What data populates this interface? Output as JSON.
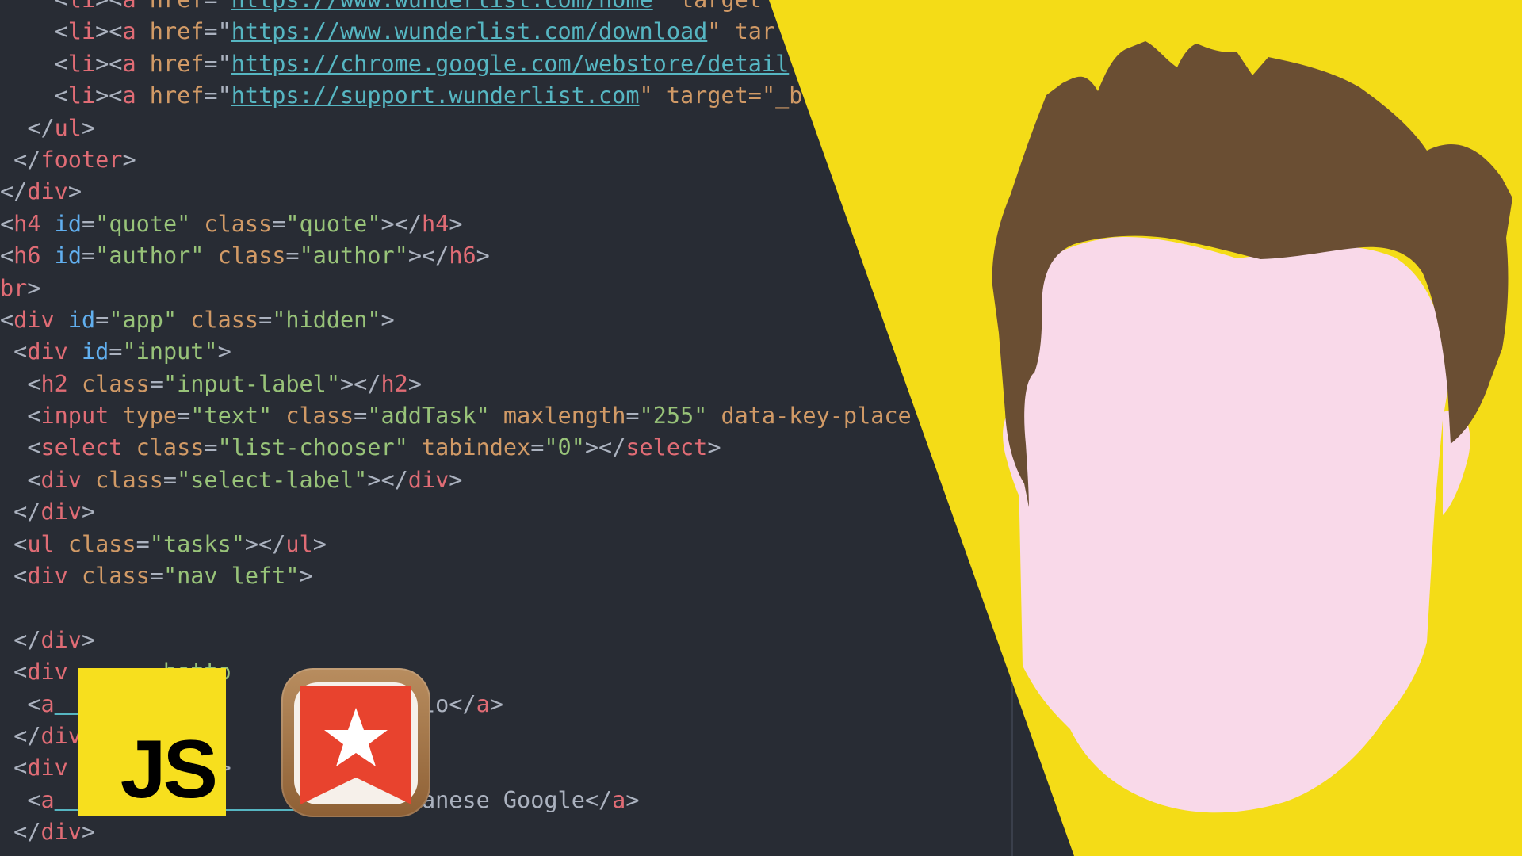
{
  "code_lines": [
    [
      {
        "t": "    <",
        "c": "txt"
      },
      {
        "t": "li",
        "c": "tag"
      },
      {
        "t": "><",
        "c": "txt"
      },
      {
        "t": "a",
        "c": "tag"
      },
      {
        "t": " href",
        "c": "attr"
      },
      {
        "t": "=\"",
        "c": "txt"
      },
      {
        "t": "https://www.wunderlist.com/home",
        "c": "url"
      },
      {
        "t": "\" target",
        "c": "attr"
      }
    ],
    [
      {
        "t": "    <",
        "c": "txt"
      },
      {
        "t": "li",
        "c": "tag"
      },
      {
        "t": "><",
        "c": "txt"
      },
      {
        "t": "a",
        "c": "tag"
      },
      {
        "t": " href",
        "c": "attr"
      },
      {
        "t": "=\"",
        "c": "txt"
      },
      {
        "t": "https://www.wunderlist.com/download",
        "c": "url"
      },
      {
        "t": "\" tar",
        "c": "attr"
      }
    ],
    [
      {
        "t": "    <",
        "c": "txt"
      },
      {
        "t": "li",
        "c": "tag"
      },
      {
        "t": "><",
        "c": "txt"
      },
      {
        "t": "a",
        "c": "tag"
      },
      {
        "t": " href",
        "c": "attr"
      },
      {
        "t": "=\"",
        "c": "txt"
      },
      {
        "t": "https://chrome.google.com/webstore/detail",
        "c": "url"
      }
    ],
    [
      {
        "t": "    <",
        "c": "txt"
      },
      {
        "t": "li",
        "c": "tag"
      },
      {
        "t": "><",
        "c": "txt"
      },
      {
        "t": "a",
        "c": "tag"
      },
      {
        "t": " href",
        "c": "attr"
      },
      {
        "t": "=\"",
        "c": "txt"
      },
      {
        "t": "https://support.wunderlist.com",
        "c": "url"
      },
      {
        "t": "\" target=\"_b",
        "c": "attr"
      }
    ],
    [
      {
        "t": "  </",
        "c": "txt"
      },
      {
        "t": "ul",
        "c": "tag"
      },
      {
        "t": ">",
        "c": "txt"
      }
    ],
    [
      {
        "t": " </",
        "c": "txt"
      },
      {
        "t": "footer",
        "c": "tag"
      },
      {
        "t": ">",
        "c": "txt"
      }
    ],
    [
      {
        "t": "</",
        "c": "txt"
      },
      {
        "t": "div",
        "c": "tag"
      },
      {
        "t": ">",
        "c": "txt"
      }
    ],
    [
      {
        "t": "<",
        "c": "txt"
      },
      {
        "t": "h4",
        "c": "tag"
      },
      {
        "t": " id",
        "c": "id"
      },
      {
        "t": "=",
        "c": "txt"
      },
      {
        "t": "\"quote\"",
        "c": "str"
      },
      {
        "t": " class",
        "c": "attr"
      },
      {
        "t": "=",
        "c": "txt"
      },
      {
        "t": "\"quote\"",
        "c": "str"
      },
      {
        "t": "></",
        "c": "txt"
      },
      {
        "t": "h4",
        "c": "tag"
      },
      {
        "t": ">",
        "c": "txt"
      }
    ],
    [
      {
        "t": "<",
        "c": "txt"
      },
      {
        "t": "h6",
        "c": "tag"
      },
      {
        "t": " id",
        "c": "id"
      },
      {
        "t": "=",
        "c": "txt"
      },
      {
        "t": "\"author\"",
        "c": "str"
      },
      {
        "t": " class",
        "c": "attr"
      },
      {
        "t": "=",
        "c": "txt"
      },
      {
        "t": "\"author\"",
        "c": "str"
      },
      {
        "t": "></",
        "c": "txt"
      },
      {
        "t": "h6",
        "c": "tag"
      },
      {
        "t": ">",
        "c": "txt"
      }
    ],
    [
      {
        "t": "br",
        "c": "tag"
      },
      {
        "t": ">",
        "c": "txt"
      }
    ],
    [
      {
        "t": "<",
        "c": "txt"
      },
      {
        "t": "div",
        "c": "tag"
      },
      {
        "t": " id",
        "c": "id"
      },
      {
        "t": "=",
        "c": "txt"
      },
      {
        "t": "\"app\"",
        "c": "str"
      },
      {
        "t": " class",
        "c": "attr"
      },
      {
        "t": "=",
        "c": "txt"
      },
      {
        "t": "\"hidden\"",
        "c": "str"
      },
      {
        "t": ">",
        "c": "txt"
      }
    ],
    [
      {
        "t": " <",
        "c": "txt"
      },
      {
        "t": "div",
        "c": "tag"
      },
      {
        "t": " id",
        "c": "id"
      },
      {
        "t": "=",
        "c": "txt"
      },
      {
        "t": "\"input\"",
        "c": "str"
      },
      {
        "t": ">",
        "c": "txt"
      }
    ],
    [
      {
        "t": "  <",
        "c": "txt"
      },
      {
        "t": "h2",
        "c": "tag"
      },
      {
        "t": " class",
        "c": "attr"
      },
      {
        "t": "=",
        "c": "txt"
      },
      {
        "t": "\"input-label\"",
        "c": "str"
      },
      {
        "t": "></",
        "c": "txt"
      },
      {
        "t": "h2",
        "c": "tag"
      },
      {
        "t": ">",
        "c": "txt"
      }
    ],
    [
      {
        "t": "  <",
        "c": "txt"
      },
      {
        "t": "input",
        "c": "tag"
      },
      {
        "t": " type",
        "c": "attr"
      },
      {
        "t": "=",
        "c": "txt"
      },
      {
        "t": "\"text\"",
        "c": "str"
      },
      {
        "t": " class",
        "c": "attr"
      },
      {
        "t": "=",
        "c": "txt"
      },
      {
        "t": "\"addTask\"",
        "c": "str"
      },
      {
        "t": " maxlength",
        "c": "attr"
      },
      {
        "t": "=",
        "c": "txt"
      },
      {
        "t": "\"255\"",
        "c": "str"
      },
      {
        "t": " data-key-place",
        "c": "attr"
      }
    ],
    [
      {
        "t": "  <",
        "c": "txt"
      },
      {
        "t": "select",
        "c": "tag"
      },
      {
        "t": " class",
        "c": "attr"
      },
      {
        "t": "=",
        "c": "txt"
      },
      {
        "t": "\"list-chooser\"",
        "c": "str"
      },
      {
        "t": " tabindex",
        "c": "attr"
      },
      {
        "t": "=",
        "c": "txt"
      },
      {
        "t": "\"0\"",
        "c": "str"
      },
      {
        "t": "></",
        "c": "txt"
      },
      {
        "t": "select",
        "c": "tag"
      },
      {
        "t": ">",
        "c": "txt"
      }
    ],
    [
      {
        "t": "  <",
        "c": "txt"
      },
      {
        "t": "div",
        "c": "tag"
      },
      {
        "t": " class",
        "c": "attr"
      },
      {
        "t": "=",
        "c": "txt"
      },
      {
        "t": "\"select-label\"",
        "c": "str"
      },
      {
        "t": "></",
        "c": "txt"
      },
      {
        "t": "div",
        "c": "tag"
      },
      {
        "t": ">",
        "c": "txt"
      }
    ],
    [
      {
        "t": " </",
        "c": "txt"
      },
      {
        "t": "div",
        "c": "tag"
      },
      {
        "t": ">",
        "c": "txt"
      }
    ],
    [
      {
        "t": " <",
        "c": "txt"
      },
      {
        "t": "ul",
        "c": "tag"
      },
      {
        "t": " class",
        "c": "attr"
      },
      {
        "t": "=",
        "c": "txt"
      },
      {
        "t": "\"tasks\"",
        "c": "str"
      },
      {
        "t": "></",
        "c": "txt"
      },
      {
        "t": "ul",
        "c": "tag"
      },
      {
        "t": ">",
        "c": "txt"
      }
    ],
    [
      {
        "t": " <",
        "c": "txt"
      },
      {
        "t": "div",
        "c": "tag"
      },
      {
        "t": " class",
        "c": "attr"
      },
      {
        "t": "=",
        "c": "txt"
      },
      {
        "t": "\"nav left\"",
        "c": "str"
      },
      {
        "t": ">",
        "c": "txt"
      }
    ],
    [],
    [
      {
        "t": " </",
        "c": "txt"
      },
      {
        "t": "div",
        "c": "tag"
      },
      {
        "t": ">",
        "c": "txt"
      }
    ],
    [
      {
        "t": " <",
        "c": "txt"
      },
      {
        "t": "div",
        "c": "tag"
      },
      {
        "t": "       botto",
        "c": "str"
      }
    ],
    [
      {
        "t": "  <",
        "c": "txt"
      },
      {
        "t": "a",
        "c": "tag"
      },
      {
        "t": "       ://go",
        "c": "url"
      },
      {
        "t": "          \">Hello</",
        "c": "txt"
      },
      {
        "t": "a",
        "c": "tag"
      },
      {
        "t": ">",
        "c": "txt"
      }
    ],
    [
      {
        "t": " </",
        "c": "txt"
      },
      {
        "t": "div",
        "c": "tag"
      }
    ],
    [
      {
        "t": " <",
        "c": "txt"
      },
      {
        "t": "div",
        "c": "tag"
      },
      {
        "t": "          \">",
        "c": "txt"
      }
    ],
    [
      {
        "t": "  <",
        "c": "txt"
      },
      {
        "t": "a",
        "c": "tag"
      },
      {
        "t": "      s://go       .jp",
        "c": "url"
      },
      {
        "t": "\">Japanese Google</",
        "c": "txt"
      },
      {
        "t": "a",
        "c": "tag"
      },
      {
        "t": ">",
        "c": "txt"
      }
    ],
    [
      {
        "t": " </",
        "c": "txt"
      },
      {
        "t": "div",
        "c": "tag"
      },
      {
        "t": ">",
        "c": "txt"
      }
    ]
  ],
  "js_logo": {
    "label": "JS",
    "background": "#f7df1e"
  },
  "wunderlist_icon": {
    "icon": "wunderlist-star-bookmark-icon",
    "colors": [
      "#e8432e",
      "#ffffff",
      "#a87848"
    ]
  },
  "illustration": {
    "icon": "faceless-person-head-icon",
    "colors": {
      "background": "#f4dc17",
      "hair": "#6a4e33",
      "skin": "#f9d9e9"
    }
  },
  "colors": {
    "editor_background": "#282c34",
    "tag": "#e06c75",
    "attribute": "#d19a66",
    "id_attr": "#61afef",
    "string": "#98c379",
    "url": "#56b6c2",
    "text": "#abb2bf"
  }
}
